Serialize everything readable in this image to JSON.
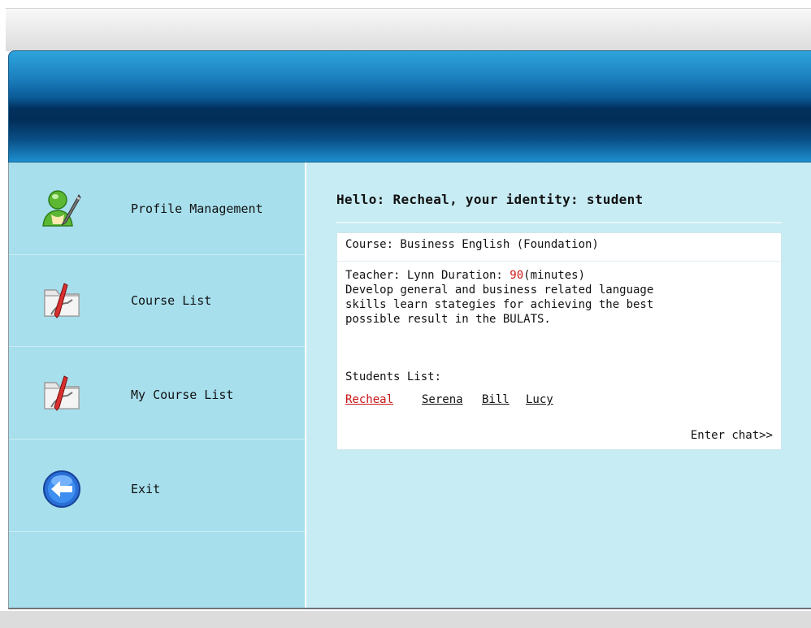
{
  "greeting": {
    "prefix": "Hello: ",
    "user": "Recheal",
    "middle": ", your identity: ",
    "identity": "student"
  },
  "sidebar": {
    "items": [
      {
        "label": "Profile Management",
        "icon": "user-edit-icon"
      },
      {
        "label": "Course List",
        "icon": "folder-pen-icon"
      },
      {
        "label": "My Course List",
        "icon": "folder-pen-icon"
      },
      {
        "label": "Exit",
        "icon": "back-arrow-icon"
      }
    ]
  },
  "course": {
    "title": "Course: Business English (Foundation)",
    "teacher_label": "Teacher: Lynn  Duration: ",
    "duration": "90",
    "duration_unit": "(minutes)",
    "description_lines": [
      "Develop general and business related language",
      "skills learn stategies for achieving the best",
      "possible result in the BULATS."
    ],
    "students_label": "Students List:",
    "students": [
      "Recheal",
      "Serena",
      "Bill",
      "Lucy"
    ],
    "enter_chat": "Enter chat>>"
  },
  "colors": {
    "accent_red": "#d01818",
    "sidebar_bg": "#a7dfed",
    "content_bg": "#c8ecf4",
    "banner_dark": "#022d58"
  }
}
